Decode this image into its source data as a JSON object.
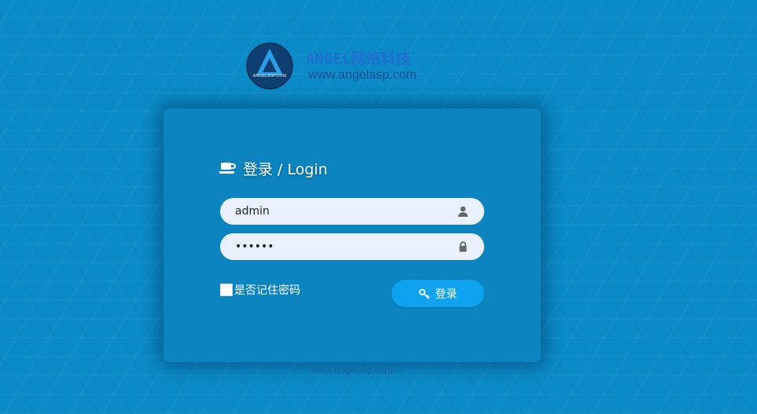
{
  "brand": {
    "title": "ANGEL网络科技",
    "url": "www.angelasp.com",
    "emblem_text": "ANGELASP.COM",
    "title_color": "#1f6fd1"
  },
  "login": {
    "heading": "登录 / Login",
    "heading_icon": "coffee-cup-icon",
    "username_value": "admin",
    "username_icon": "user-icon",
    "password_value": "123456",
    "password_icon": "lock-icon",
    "remember_label": "是否记住密码",
    "remember_checked": false,
    "submit_label": "登录",
    "submit_icon": "key-icon",
    "button_color": "#0fa2ee"
  },
  "footer": {
    "text": "www.angelasp.com"
  },
  "colors": {
    "background": "#0a8ac6",
    "panel": "#0b84c0",
    "input": "#e8f1fd"
  }
}
